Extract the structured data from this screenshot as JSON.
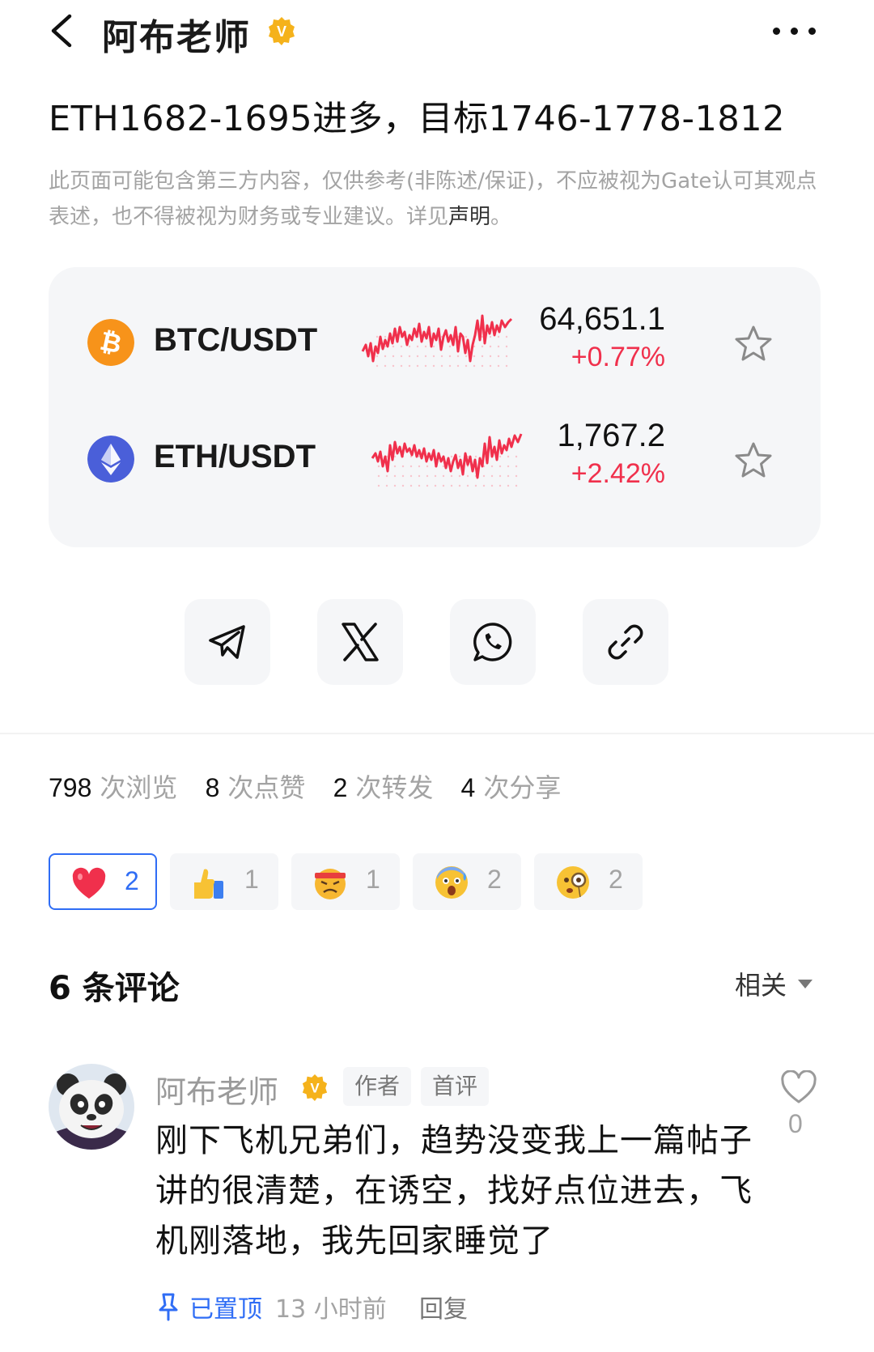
{
  "header": {
    "author_name": "阿布老师",
    "verified_badge": "V"
  },
  "post": {
    "title": "ETH1682-1695进多，目标1746-1778-1812",
    "disclaimer_text": "此页面可能包含第三方内容，仅供参考(非陈述/保证)，不应被视为Gate认可其观点表述，也不得被视为财务或专业建议。详见",
    "disclaimer_link": "声明",
    "disclaimer_end": "。"
  },
  "market": {
    "tickers": [
      {
        "pair": "BTC/USDT",
        "price": "64,651.1",
        "change": "+0.77%",
        "icon": "bitcoin-icon",
        "color": "#f7931a"
      },
      {
        "pair": "ETH/USDT",
        "price": "1,767.2",
        "change": "+2.42%",
        "icon": "ethereum-icon",
        "color": "#4a5fd9"
      }
    ],
    "up_color": "#f0304c"
  },
  "share": [
    {
      "icon": "telegram-icon"
    },
    {
      "icon": "x-icon"
    },
    {
      "icon": "whatsapp-icon"
    },
    {
      "icon": "link-icon"
    }
  ],
  "stats": [
    {
      "num": "798",
      "label": "次浏览"
    },
    {
      "num": "8",
      "label": "次点赞"
    },
    {
      "num": "2",
      "label": "次转发"
    },
    {
      "num": "4",
      "label": "次分享"
    }
  ],
  "reactions": [
    {
      "icon": "heart-emoji-icon",
      "count": "2",
      "active": true
    },
    {
      "icon": "thumbs-up-emoji-icon",
      "count": "1",
      "active": false
    },
    {
      "icon": "angry-face-emoji-icon",
      "count": "1",
      "active": false
    },
    {
      "icon": "fearful-face-emoji-icon",
      "count": "2",
      "active": false
    },
    {
      "icon": "monocle-face-emoji-icon",
      "count": "2",
      "active": false
    }
  ],
  "comments": {
    "count_label": "6 条评论",
    "sort_label": "相关",
    "items": [
      {
        "author": "阿布老师",
        "tags": [
          "作者",
          "首评"
        ],
        "text": "刚下飞机兄弟们，趋势没变我上一篇帖子讲的很清楚，在诱空，找好点位进去，飞机刚落地，我先回家睡觉了",
        "likes": "0",
        "pinned_label": "已置顶",
        "time": "13 小时前",
        "reply_label": "回复"
      }
    ]
  },
  "accent_color": "#2f6df5"
}
